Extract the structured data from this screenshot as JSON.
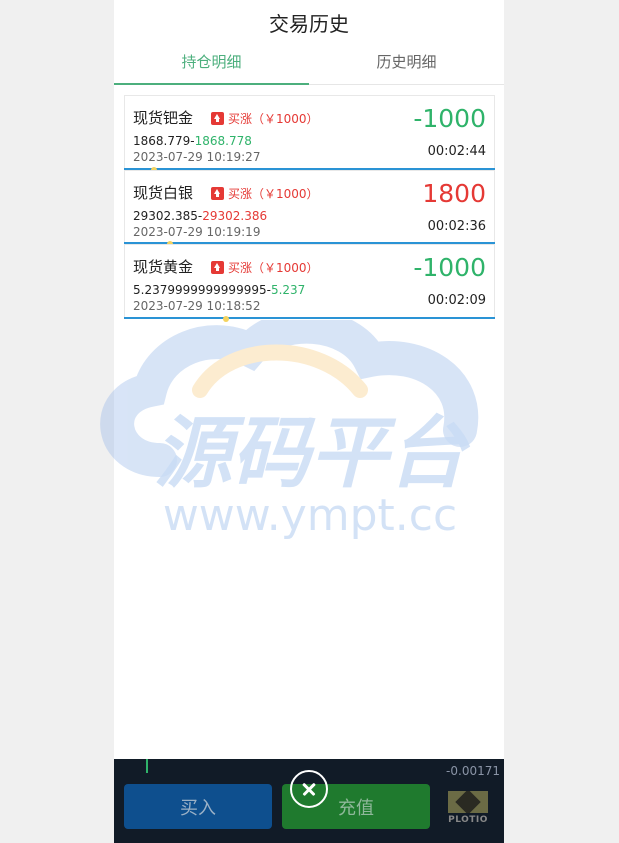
{
  "header": {
    "title": "交易历史"
  },
  "tabs": [
    {
      "label": "持仓明细",
      "active": true
    },
    {
      "label": "历史明细",
      "active": false
    }
  ],
  "positions": [
    {
      "name": "现货钯金",
      "direction": "买涨（￥1000）",
      "open_price": "1868.779",
      "current_price": "1868.778",
      "current_color": "green",
      "time": "2023-07-29 10:19:27",
      "amount": "-1000",
      "duration": "00:02:44"
    },
    {
      "name": "现货白银",
      "direction": "买涨（￥1000）",
      "open_price": "29302.385",
      "current_price": "29302.386",
      "current_color": "red",
      "time": "2023-07-29 10:19:19",
      "amount": "1800",
      "duration": "00:02:36"
    },
    {
      "name": "现货黄金",
      "direction": "买涨（￥1000）",
      "open_price": "5.2379999999999995",
      "current_price": "5.237",
      "current_color": "green",
      "time": "2023-07-29 10:18:52",
      "amount": "-1000",
      "duration": "00:02:09"
    }
  ],
  "bottom_bar": {
    "ticker": "-0.00171",
    "buy_label": "买入",
    "recharge_label": "充值",
    "logo_text": "PLOTIO"
  },
  "watermark": {
    "title": "源码平台",
    "url": "www.ympt.cc"
  },
  "colors": {
    "accent": "#4caf7d",
    "down": "#2fb36a",
    "up": "#e53935",
    "line": "#2a93d5"
  }
}
